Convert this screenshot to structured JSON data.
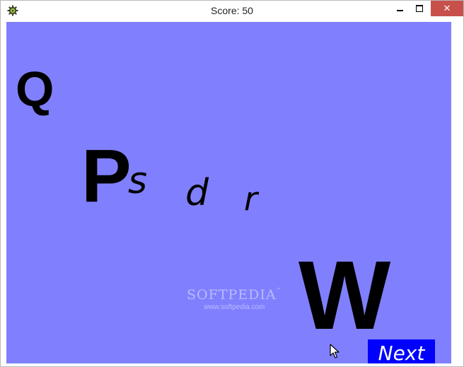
{
  "window": {
    "title": "Score: 50",
    "icon": "gear-icon",
    "controls": {
      "minimize": "minimize-icon",
      "maximize": "maximize-icon",
      "close": "close-icon",
      "close_glyph": "✕"
    }
  },
  "game": {
    "background_color": "#8080ff",
    "letters": {
      "q": "Q",
      "p": "P",
      "s": "s",
      "d": "d",
      "r": "r",
      "w": "W"
    },
    "next_button": {
      "label": "Next",
      "color": "#0000ff"
    },
    "watermark": {
      "brand": "SOFTPEDIA",
      "trademark": "™",
      "url": "www.softpedia.com"
    }
  }
}
